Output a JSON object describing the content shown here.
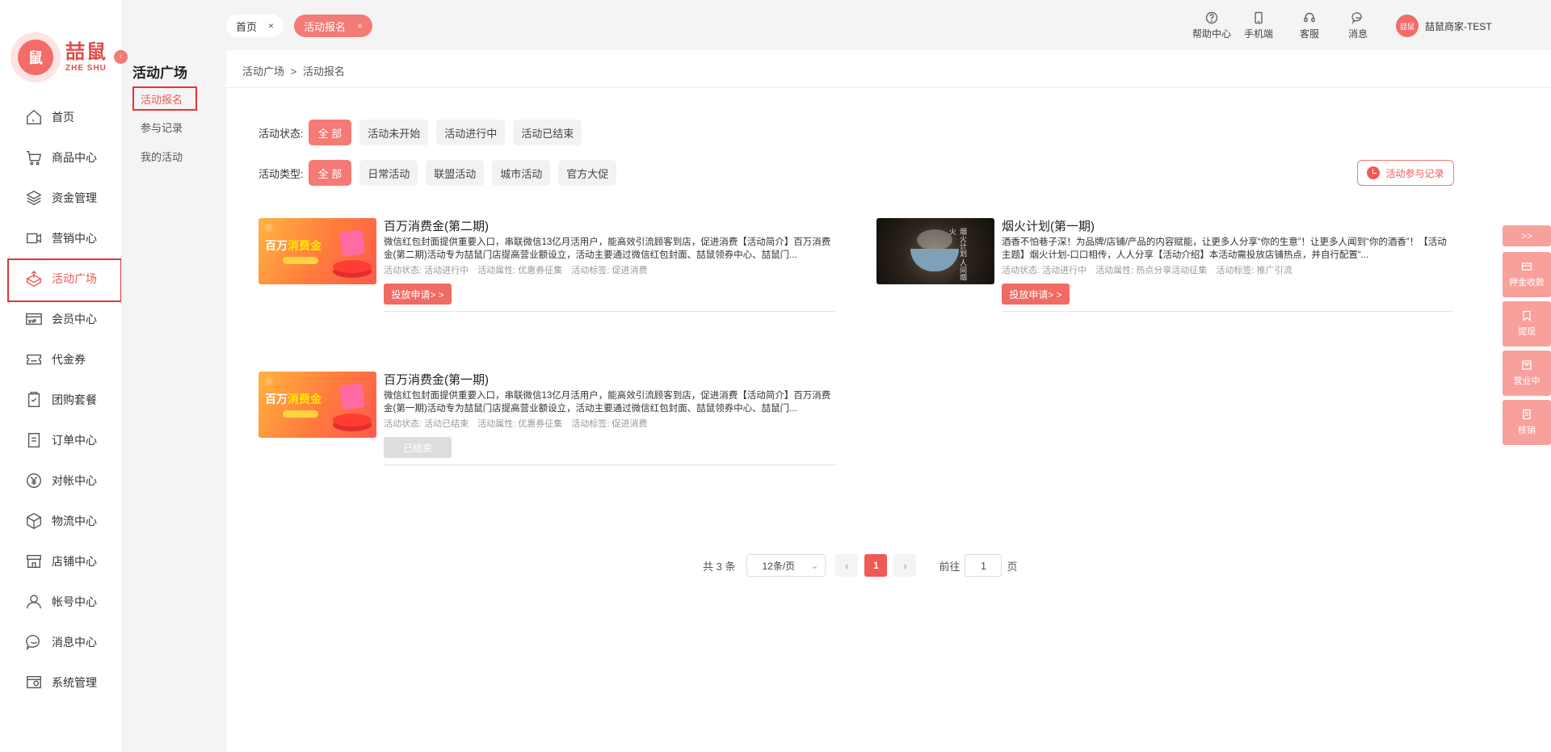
{
  "brand": {
    "name": "喆鼠",
    "latin": "ZHE SHU",
    "mark": "鼠"
  },
  "sidebar": {
    "items": [
      {
        "label": "首页",
        "icon": "home-icon"
      },
      {
        "label": "商品中心",
        "icon": "cart-icon"
      },
      {
        "label": "资金管理",
        "icon": "layers-icon"
      },
      {
        "label": "营销中心",
        "icon": "video-icon"
      },
      {
        "label": "活动广场",
        "icon": "box-upload-icon",
        "active": true
      },
      {
        "label": "会员中心",
        "icon": "vip-card-icon"
      },
      {
        "label": "代金券",
        "icon": "coupon-icon"
      },
      {
        "label": "团购套餐",
        "icon": "bag-icon"
      },
      {
        "label": "订单中心",
        "icon": "order-icon"
      },
      {
        "label": "对帐中心",
        "icon": "yen-icon"
      },
      {
        "label": "物流中心",
        "icon": "cube-icon"
      },
      {
        "label": "店铺中心",
        "icon": "store-icon"
      },
      {
        "label": "帐号中心",
        "icon": "user-icon"
      },
      {
        "label": "消息中心",
        "icon": "chat-icon"
      },
      {
        "label": "系统管理",
        "icon": "settings-icon"
      }
    ]
  },
  "subnav": {
    "title": "活动广场",
    "items": [
      "活动报名",
      "参与记录",
      "我的活动"
    ]
  },
  "tabs": [
    {
      "label": "首页",
      "close": "×"
    },
    {
      "label": "活动报名",
      "close": "×"
    }
  ],
  "toolbar": {
    "help": "帮助中心",
    "mobile": "手机端",
    "service": "客服",
    "message": "消息",
    "user": "喆鼠商家-TEST",
    "avatar_text": "喆鼠"
  },
  "breadcrumb": {
    "parent": "活动广场",
    "sep": ">",
    "current": "活动报名"
  },
  "filters": {
    "status_label": "活动状态:",
    "status_options": [
      "全 部",
      "活动未开始",
      "活动进行中",
      "活动已结束"
    ],
    "type_label": "活动类型:",
    "type_options": [
      "全 部",
      "日常活动",
      "联盟活动",
      "城市活动",
      "官方大促"
    ],
    "record_button": "活动参与记录"
  },
  "activities": [
    {
      "title": "百万消费金(第二期)",
      "desc": "微信红包封面提供重要入口，串联微信13亿月活用户，能高效引流顾客到店，促进消费【活动简介】百万消费金(第二期)活动专为喆鼠门店提高营业额设立，活动主要通过微信红包封面、喆鼠领券中心、喆鼠门...",
      "status": "活动状态: 活动进行中",
      "attr": "活动属性: 优惠券征集",
      "tag": "活动标签: 促进消费",
      "button": "投放申请> >",
      "thumb_text": "百万",
      "thumb_highlight": "消费金"
    },
    {
      "title": "烟火计划(第一期)",
      "desc": "酒香不怕巷子深！为品牌/店铺/产品的内容赋能，让更多人分享“你的生意”！让更多人闻到“你的酒香”！【活动主题】烟火计划-口口相传，人人分享【活动介绍】本活动需投放店铺热点，并自行配置“...",
      "status": "活动状态: 活动进行中",
      "attr": "活动属性: 热点分享活动征集",
      "tag": "活动标签: 推广引流",
      "button": "投放申请> >",
      "thumb_text": "烟火计划 人间烟火"
    },
    {
      "title": "百万消费金(第一期)",
      "desc": "微信红包封面提供重要入口，串联微信13亿月活用户，能高效引流顾客到店，促进消费【活动简介】百万消费金(第一期)活动专为喆鼠门店提高营业额设立，活动主要通过微信红包封面、喆鼠领券中心、喆鼠门...",
      "status": "活动状态: 活动已结束",
      "attr": "活动属性: 优惠券征集",
      "tag": "活动标签: 促进消费",
      "button": "已结束",
      "thumb_text": "百万",
      "thumb_highlight": "消费金"
    }
  ],
  "pagination": {
    "total": "共 3 条",
    "page_size": "12条/页",
    "current_page": "1",
    "goto_label": "前往",
    "goto_value": "1",
    "page_unit": "页",
    "prev": "‹",
    "next": "›",
    "select_arrow": "⌄"
  },
  "floating": {
    "expand": ">>",
    "items": [
      "押金收款",
      "提现",
      "营业中",
      "核销"
    ]
  },
  "colors": {
    "accent": "#f05a55",
    "accent_light": "#f47a75",
    "highlight_border": "#e93434"
  }
}
